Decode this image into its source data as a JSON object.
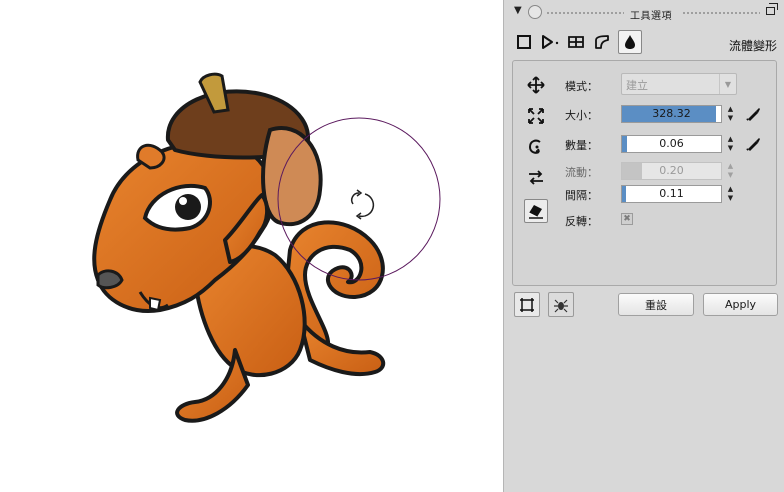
{
  "panel": {
    "title": "工具選項",
    "tool_name": "流體變形",
    "tools": [
      {
        "name": "rect-select-tool-icon",
        "active": false
      },
      {
        "name": "lasso-tool-icon",
        "active": false
      },
      {
        "name": "transform-tool-icon",
        "active": false
      },
      {
        "name": "warp-tool-icon",
        "active": false
      },
      {
        "name": "liquify-tool-icon",
        "active": true
      }
    ],
    "side_icons": [
      {
        "name": "push-icon",
        "active": false
      },
      {
        "name": "expand-icon",
        "active": false
      },
      {
        "name": "twirl-icon",
        "active": false
      },
      {
        "name": "pinch-icon",
        "active": false
      },
      {
        "name": "eraser-icon",
        "active": true
      }
    ],
    "mode": {
      "label": "模式：",
      "value": "建立"
    },
    "size": {
      "label": "大小：",
      "value": "328.32",
      "fill_fraction": 0.95
    },
    "amount": {
      "label": "數量：",
      "value": "0.06",
      "fill_fraction": 0.05
    },
    "flow": {
      "label": "流動：",
      "value": "0.20",
      "fill_fraction": 0.2
    },
    "spacing": {
      "label": "間隔：",
      "value": "0.11",
      "fill_fraction": 0.04
    },
    "invert": {
      "label": "反轉：",
      "checked": true,
      "mark": "✖"
    },
    "reset_label": "重設",
    "apply_label": "Apply",
    "accent_color": "#5b8ec4"
  }
}
